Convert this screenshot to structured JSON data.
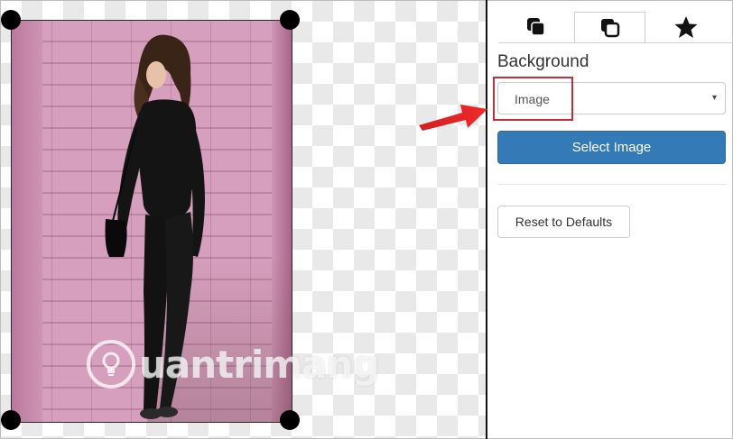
{
  "canvas": {
    "watermark_text": "uantrimang",
    "watermark_icon": "lightbulb-icon",
    "handle_icon": "resize-handle"
  },
  "tabs": [
    {
      "icon": "copy-filled-icon",
      "glyph": "❐",
      "active": false
    },
    {
      "icon": "copy-outline-icon",
      "glyph": "⧉",
      "active": true
    },
    {
      "icon": "star-icon",
      "glyph": "★",
      "active": false
    }
  ],
  "panel": {
    "section_title": "Background",
    "background_select": {
      "value": "Image",
      "caret": "▾"
    },
    "select_image_label": "Select Image",
    "reset_label": "Reset to Defaults"
  },
  "colors": {
    "primary": "#337ab7",
    "highlight": "#c0303c",
    "arrow": "#e02525"
  }
}
